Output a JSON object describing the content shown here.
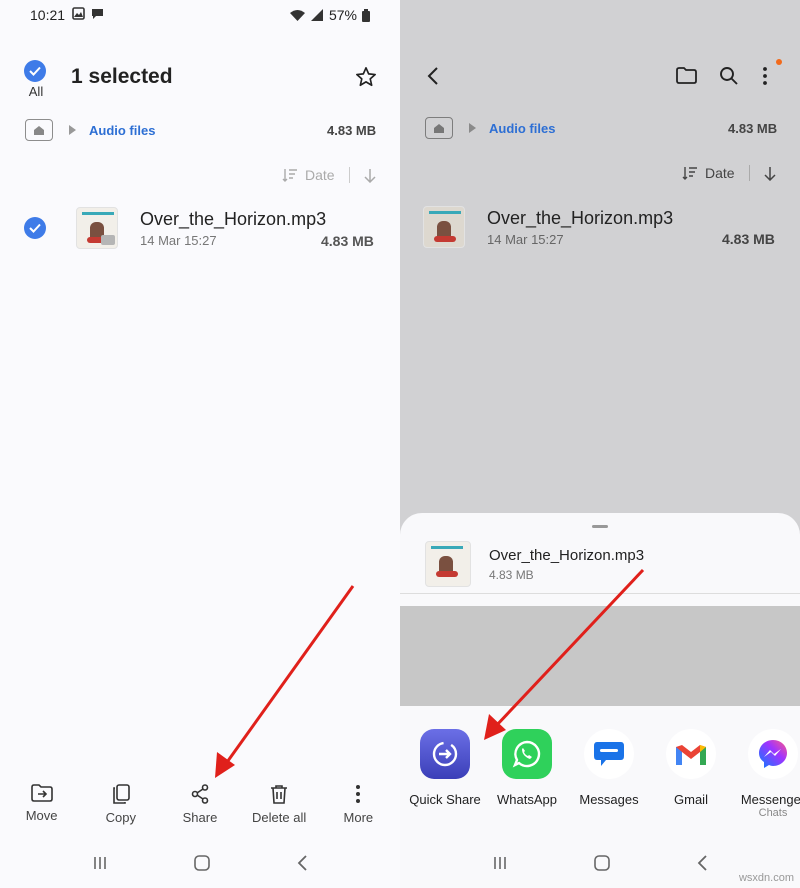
{
  "left": {
    "status": {
      "time": "10:21",
      "battery": "57%"
    },
    "header": {
      "select_all_label": "All",
      "title": "1 selected"
    },
    "path": {
      "folder": "Audio files",
      "size": "4.83 MB"
    },
    "sort": {
      "label": "Date"
    },
    "file": {
      "name": "Over_the_Horizon.mp3",
      "meta": "14 Mar 15:27",
      "size": "4.83 MB"
    },
    "toolbar": [
      {
        "label": "Move",
        "icon": "move-icon"
      },
      {
        "label": "Copy",
        "icon": "copy-icon"
      },
      {
        "label": "Share",
        "icon": "share-icon"
      },
      {
        "label": "Delete all",
        "icon": "trash-icon"
      },
      {
        "label": "More",
        "icon": "more-icon"
      }
    ]
  },
  "right": {
    "path": {
      "folder": "Audio files",
      "size": "4.83 MB"
    },
    "sort": {
      "label": "Date"
    },
    "file": {
      "name": "Over_the_Horizon.mp3",
      "meta": "14 Mar 15:27",
      "size": "4.83 MB"
    },
    "sheet": {
      "file_name": "Over_the_Horizon.mp3",
      "file_size": "4.83 MB",
      "apps": [
        {
          "label": "Quick Share",
          "sub": "",
          "icon": "quick-share-icon"
        },
        {
          "label": "WhatsApp",
          "sub": "",
          "icon": "whatsapp-icon"
        },
        {
          "label": "Messages",
          "sub": "",
          "icon": "messages-icon"
        },
        {
          "label": "Gmail",
          "sub": "",
          "icon": "gmail-icon"
        },
        {
          "label": "Messenger",
          "sub": "Chats",
          "icon": "messenger-icon"
        }
      ]
    }
  },
  "watermark": "wsxdn.com",
  "colors": {
    "accent": "#3e7be8",
    "link": "#2d6fd4",
    "arrow": "#e0201b",
    "sheet_bg": "#f9f9fb",
    "dim_bg": "#d1d1d3"
  }
}
